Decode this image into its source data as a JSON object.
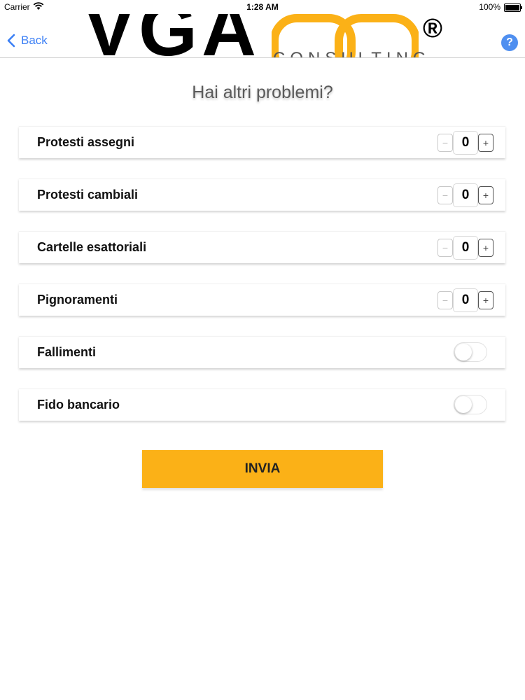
{
  "status_bar": {
    "carrier": "Carrier",
    "time": "1:28 AM",
    "battery": "100%"
  },
  "nav": {
    "back_label": "Back",
    "help_label": "?"
  },
  "logo": {
    "wordmark": "VGA",
    "subtitle": "CONSULTING",
    "registered": "®",
    "accent_color": "#fbb117"
  },
  "page": {
    "title": "Hai altri problemi?"
  },
  "items": [
    {
      "label": "Protesti assegni",
      "control": "stepper",
      "value": "0",
      "minus": "−",
      "plus": "+"
    },
    {
      "label": "Protesti cambiali",
      "control": "stepper",
      "value": "0",
      "minus": "−",
      "plus": "+"
    },
    {
      "label": "Cartelle esattoriali",
      "control": "stepper",
      "value": "0",
      "minus": "−",
      "plus": "+"
    },
    {
      "label": "Pignoramenti",
      "control": "stepper",
      "value": "0",
      "minus": "−",
      "plus": "+"
    },
    {
      "label": "Fallimenti",
      "control": "toggle",
      "on": false
    },
    {
      "label": "Fido bancario",
      "control": "toggle",
      "on": false
    }
  ],
  "submit": {
    "label": "INVIA",
    "color": "#fbb117"
  }
}
